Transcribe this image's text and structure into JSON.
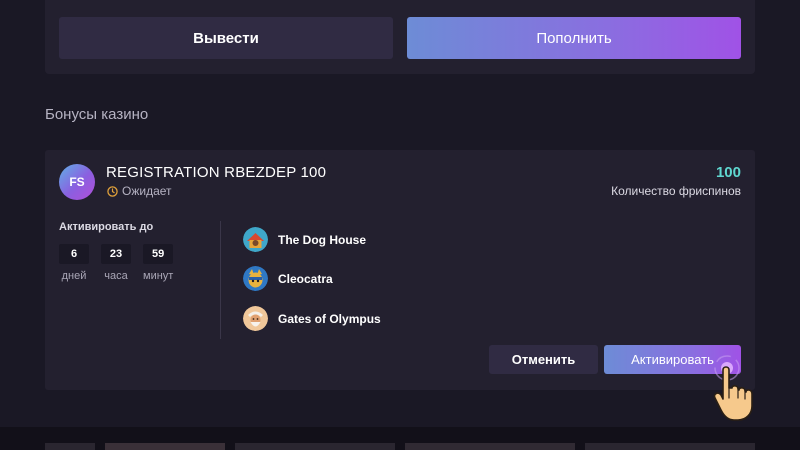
{
  "wallet": {
    "withdraw_label": "Вывести",
    "deposit_label": "Пополнить"
  },
  "bonuses_section": {
    "title": "Бонусы казино"
  },
  "bonus": {
    "avatar_text": "FS",
    "name": "REGISTRATION RBEZDEP 100",
    "status": "Ожидает",
    "spins_count": "100",
    "spins_label": "Количество фриспинов",
    "activate_until_label": "Активировать до",
    "timer": {
      "days": "6",
      "days_label": "дней",
      "hours": "23",
      "hours_label": "часа",
      "minutes": "59",
      "minutes_label": "минут"
    },
    "games": [
      {
        "name": "The Dog House",
        "icon": "dog-house-icon"
      },
      {
        "name": "Cleocatra",
        "icon": "cleocatra-icon"
      },
      {
        "name": "Gates of Olympus",
        "icon": "gates-of-olympus-icon"
      }
    ],
    "cancel_label": "Отменить",
    "activate_label": "Активировать"
  },
  "colors": {
    "background": "#1a1825",
    "panel": "#23202f",
    "secondary_button": "#302b43",
    "accent_teal": "#5fd7d0",
    "gradient_start": "#6d8cd6",
    "gradient_end": "#a052e6",
    "status_clock": "#e2a23b"
  }
}
